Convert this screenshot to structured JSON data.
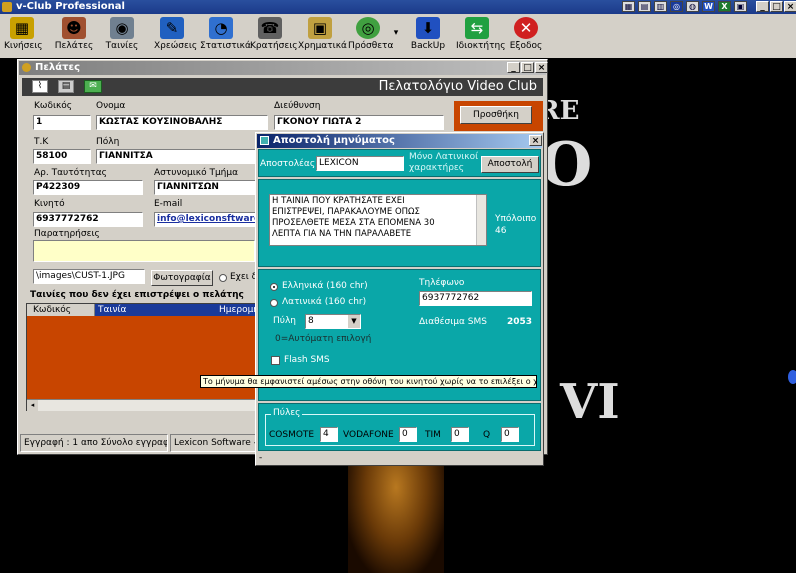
{
  "app": {
    "title": "v-Club Professional",
    "window_controls": [
      "_",
      "□",
      "×"
    ]
  },
  "toolbar": {
    "items": [
      {
        "label": "Κινήσεις",
        "icon": "film-reel-icon",
        "color": "#c8a000"
      },
      {
        "label": "Πελάτες",
        "icon": "people-icon",
        "color": "#a05030"
      },
      {
        "label": "Ταινίες",
        "icon": "film-icon",
        "color": "#708090"
      },
      {
        "label": "Χρεώσεις",
        "icon": "charges-icon",
        "color": "#2060c0"
      },
      {
        "label": "Στατιστικά",
        "icon": "pie-chart-icon",
        "color": "#3070d0"
      },
      {
        "label": "Κρατήσεις",
        "icon": "reservations-icon",
        "color": "#606060"
      },
      {
        "label": "Χρηματικά",
        "icon": "money-icon",
        "color": "#c0a040"
      },
      {
        "label": "Πρόσθετα",
        "icon": "cd-icon",
        "color": "#40a040"
      },
      {
        "label": "BackUp",
        "icon": "backup-icon",
        "color": "#2050c0"
      },
      {
        "label": "Ιδιοκτήτης",
        "icon": "owner-icon",
        "color": "#20a040"
      },
      {
        "label": "Εξοδος",
        "icon": "exit-icon",
        "color": "#d02020"
      }
    ]
  },
  "background": {
    "deco_top": "RE",
    "deco_mid": "O",
    "deco_bottom": "VI"
  },
  "customers": {
    "title": "Πελάτες",
    "banner": "Πελατολόγιο Video Club",
    "labels": {
      "code": "Κωδικός",
      "name": "Ονομα",
      "address": "Διεύθυνση",
      "zip": "Τ.Κ",
      "city": "Πόλη",
      "id_number": "Αρ. Ταυτότητας",
      "police_dept": "Αστυνομικό Τμήμα",
      "mobile": "Κινητό",
      "email": "E-mail",
      "notes": "Παρατηρήσεις"
    },
    "values": {
      "code": "1",
      "name": "ΚΩΣΤΑΣ ΚΟΥΣΙΝΟΒΑΛΗΣ",
      "address": "ΓΚΟΝΟΥ ΓΙΩΤΑ 2",
      "zip": "58100",
      "city": "ΓΙΑΝΝΙΤΣΑ",
      "id_number": "Ρ422309",
      "police_dept": "ΓΙΑΝΝΙΤΣΩΝ",
      "mobile": "6937772762",
      "email": "info@lexiconsftware.g",
      "photo_path": "\\images\\CUST-1.JPG"
    },
    "add_button": "Προσθήκη",
    "photo_button": "Φωτογραφία",
    "has_option": "Εχει δ",
    "unreturned_title": "Ταινίες που δεν έχει επιστρέψει ο πελάτης",
    "columns": [
      "Κωδικός",
      "Ταινία",
      "Ημερομην"
    ],
    "status_left": "Εγγραφή : 1 απο Σύνολο εγγραφών 1",
    "status_right": "Lexicon Software - vC"
  },
  "sms": {
    "title": "Αποστολή μηνύματος",
    "sender_label": "Αποστολέας :",
    "sender_value": "LEXICON",
    "latin_note_1": "Μόνο Λατινικοί",
    "latin_note_2": "χαρακτήρες",
    "send_button": "Αποστολή",
    "message_lines": [
      "Η ΤΑΙΝΙΑ ΠΟΥ ΚΡΑΤΗΣΑΤΕ ΕΧΕΙ",
      "ΕΠΙΣΤΡΕΨΕΙ, ΠΑΡΑΚΑΛΟΥΜΕ ΟΠΩΣ",
      "ΠΡΟΣΕΛΘΕΤΕ ΜΕΣΑ ΣΤΑ ΕΠΟΜΕΝΑ 30",
      "ΛΕΠΤΑ ΓΙΑ ΝΑ ΤΗΝ ΠΑΡΑΛΑΒΕΤΕ"
    ],
    "remaining_label": "Υπόλοιπο",
    "remaining_value": "46",
    "greek_option": "Ελληνικά (160 chr)",
    "latin_option": "Λατινικά (160 chr)",
    "gateway_label": "Πύλη",
    "gateway_value": "8",
    "auto_note": "0=Αυτόματη επιλογή",
    "flash_label": "Flash SMS",
    "tooltip": "Το μήνυμα θα εμφανιστεί αμέσως στην οθόνη του κινητού χωρίς να το επιλέξει ο χρήστης",
    "phone_label": "Τηλέφωνο",
    "phone_value": "6937772762",
    "available_label": "Διαθέσιμα SMS",
    "available_value": "2053",
    "gateways_legend": "Πύλες",
    "gateways": [
      {
        "name": "COSMOTE",
        "value": "4"
      },
      {
        "name": "VODAFONE",
        "value": "0"
      },
      {
        "name": "TIM",
        "value": "0"
      },
      {
        "name": "Q",
        "value": "0"
      }
    ],
    "bottom_mark": "-"
  }
}
